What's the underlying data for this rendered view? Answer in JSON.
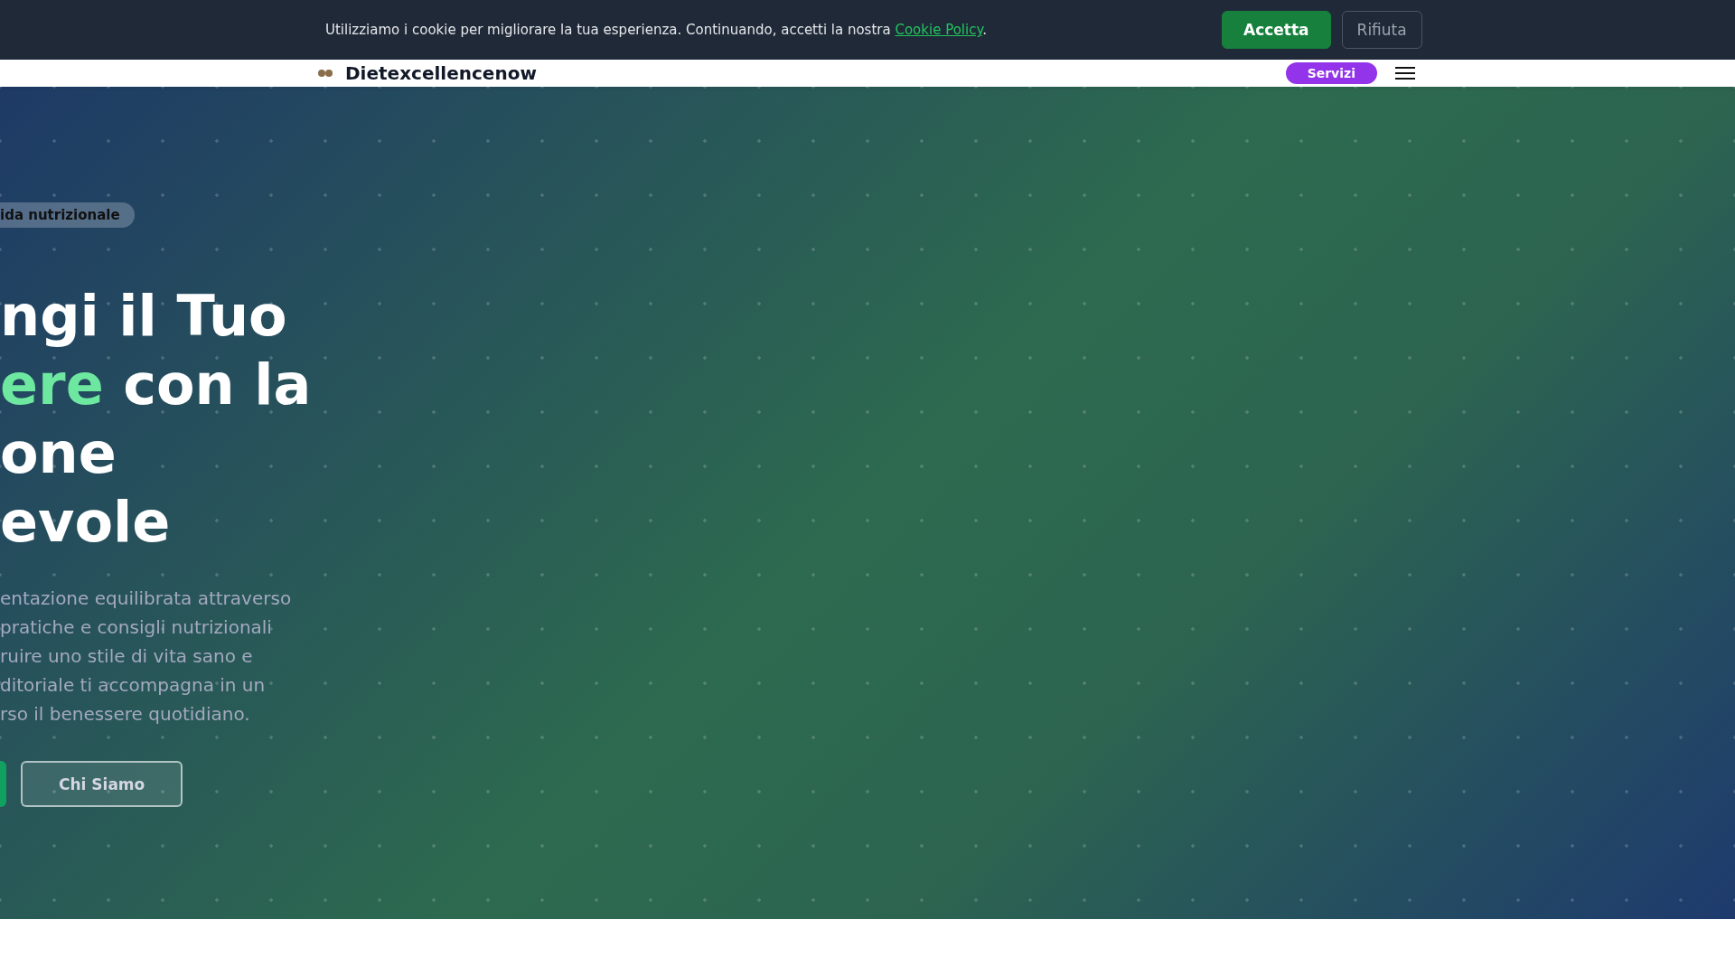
{
  "cookie_banner": {
    "message": "Utilizziamo i cookie per migliorare la tua esperienza. Continuando, accetti la nostra",
    "link": "Cookie Policy",
    "after_link": ".",
    "buttons": [
      {
        "label": "Accetta",
        "kind": "primary"
      },
      {
        "label": "Rifiuta",
        "kind": "secondary"
      }
    ]
  },
  "navbar": {
    "logo": "Dietexcellencenow",
    "cta": "Servizi"
  },
  "hero": {
    "badge": "ida nutrizionale",
    "title_lines": [
      [
        {
          "text": "ngi il Tuo",
          "highlight": false
        }
      ],
      [
        {
          "text": "ere",
          "highlight": true
        },
        {
          "text": " con la",
          "highlight": false
        }
      ],
      [
        {
          "text": "one",
          "highlight": false
        }
      ],
      [
        {
          "text": "evole",
          "highlight": false
        }
      ]
    ],
    "paragraph_lines": [
      "entazione equilibrata attraverso",
      "pratiche e consigli nutrizionali",
      "ruire uno stile di vita sano e",
      "ditoriale ti accompagna in un",
      "rso il benessere quotidiano."
    ],
    "buttons": [
      {
        "kind": "primary"
      },
      {
        "kind": "outline",
        "label": "Chi Siamo"
      }
    ]
  }
}
